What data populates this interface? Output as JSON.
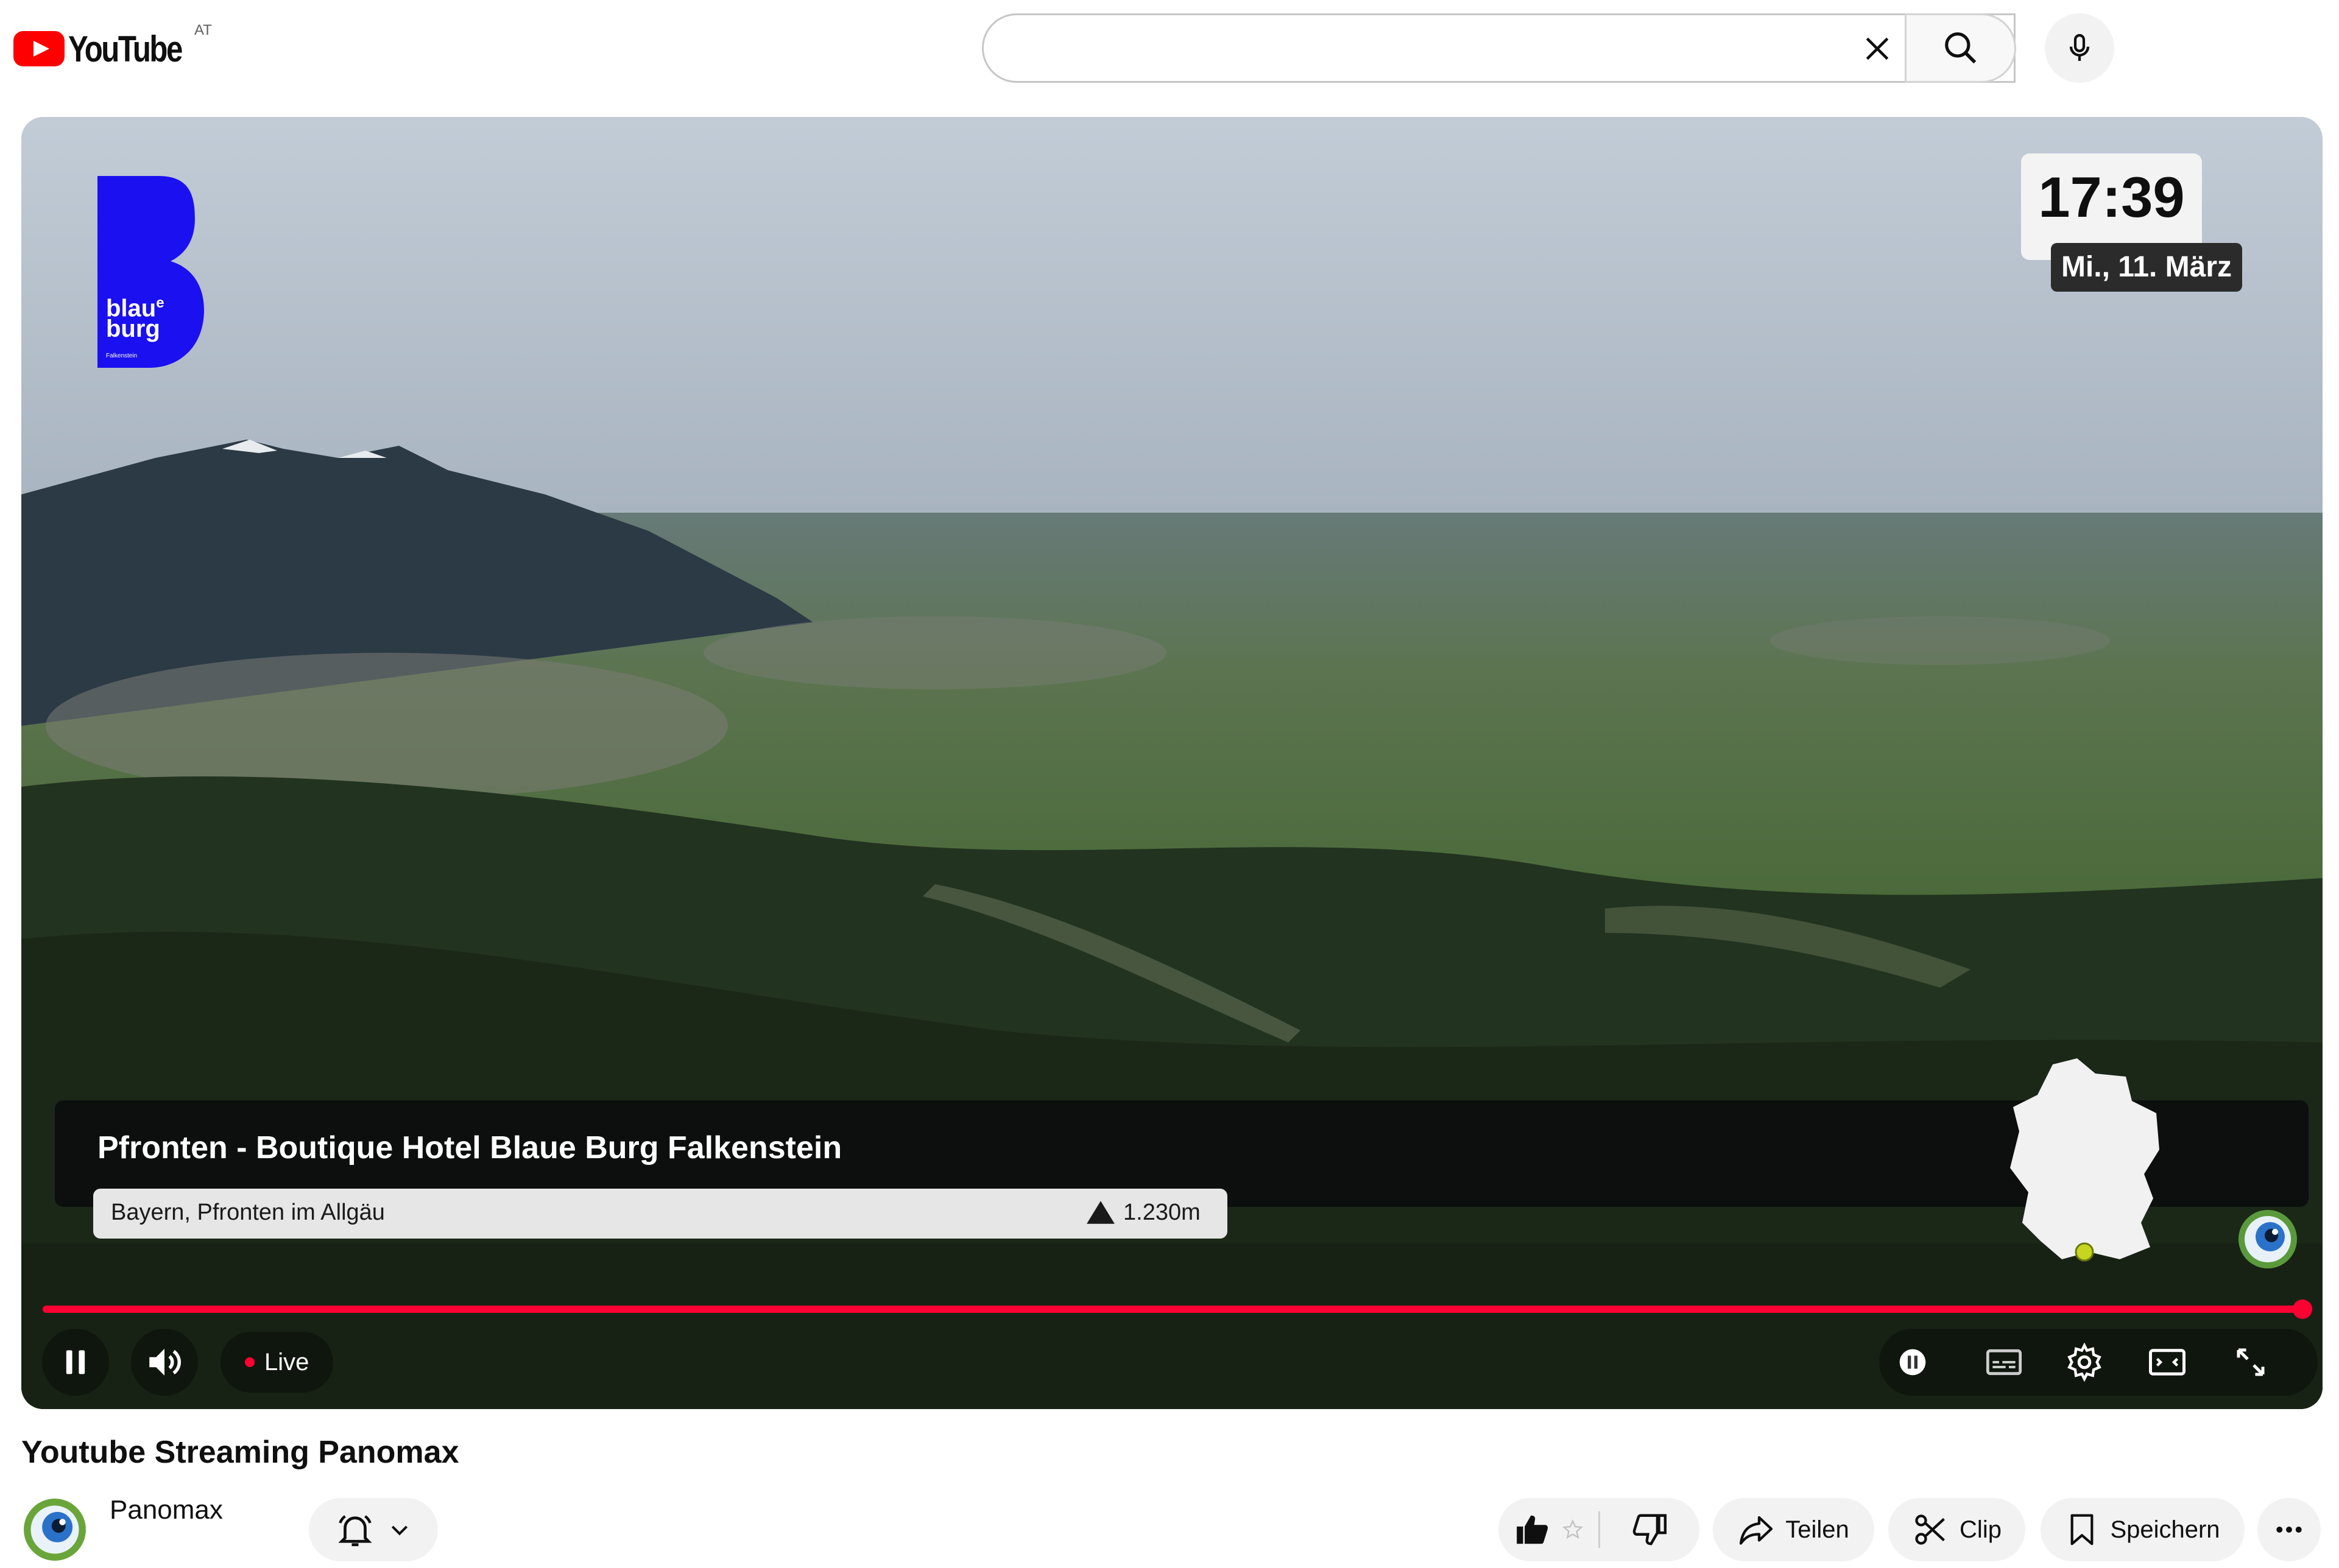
{
  "header": {
    "logo_text": "YouTube",
    "country_code": "AT",
    "search_value": "",
    "icons": {
      "clear": "close-icon",
      "search": "search-icon",
      "mic": "mic-icon"
    }
  },
  "player": {
    "overlay_brand": {
      "line1": "blau",
      "sup": "e",
      "line2": "burg",
      "line3": "Falkenstein"
    },
    "clock": {
      "time": "17:39",
      "date": "Mi., 11. März"
    },
    "info": {
      "title": "Pfronten - Boutique Hotel Blaue Burg Falkenstein",
      "location": "Bayern, Pfronten im Allgäu",
      "altitude": "1.230m"
    },
    "progress": {
      "fraction": 1.0,
      "color": "#ff0033"
    },
    "controls": {
      "live_label": "Live",
      "left_icons": [
        "pause-icon",
        "volume-icon"
      ],
      "right_icons": [
        "autoplay-toggle-icon",
        "subtitles-icon",
        "settings-icon",
        "theater-mode-icon",
        "fullscreen-icon"
      ]
    }
  },
  "video": {
    "title": "Youtube Streaming Panomax",
    "channel": "Panomax",
    "actions": {
      "share": "Teilen",
      "clip": "Clip",
      "save": "Speichern"
    }
  },
  "colors": {
    "accent": "#ff0000",
    "live": "#ff0033",
    "brand_blue": "#1a10f0"
  }
}
